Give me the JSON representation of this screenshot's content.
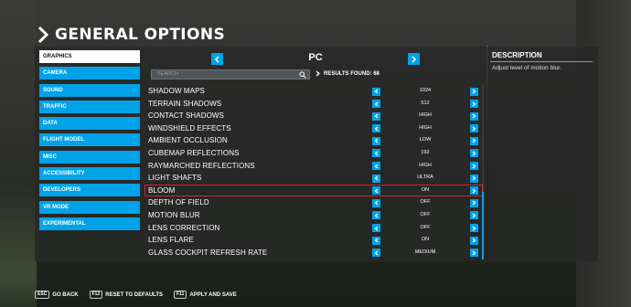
{
  "header": {
    "title": "GENERAL OPTIONS"
  },
  "sidebar": {
    "items": [
      {
        "label": "GRAPHICS",
        "active": true
      },
      {
        "label": "CAMERA"
      },
      {
        "label": "SOUND"
      },
      {
        "label": "TRAFFIC"
      },
      {
        "label": "DATA"
      },
      {
        "label": "FLIGHT MODEL"
      },
      {
        "label": "MISC"
      },
      {
        "label": "ACCESSIBILITY"
      },
      {
        "label": "DEVELOPERS"
      },
      {
        "label": "VR MODE"
      },
      {
        "label": "EXPERIMENTAL"
      }
    ]
  },
  "platform": {
    "label": "PC"
  },
  "search": {
    "placeholder": "SEARCH",
    "results_label": "RESULTS FOUND: 68"
  },
  "settings": [
    {
      "name": "SHADOW MAPS",
      "value": "1024"
    },
    {
      "name": "TERRAIN SHADOWS",
      "value": "512"
    },
    {
      "name": "CONTACT SHADOWS",
      "value": "HIGH"
    },
    {
      "name": "WINDSHIELD EFFECTS",
      "value": "HIGH"
    },
    {
      "name": "AMBIENT OCCLUSION",
      "value": "LOW"
    },
    {
      "name": "CUBEMAP REFLECTIONS",
      "value": "192"
    },
    {
      "name": "RAYMARCHED REFLECTIONS",
      "value": "HIGH"
    },
    {
      "name": "LIGHT SHAFTS",
      "value": "ULTRA"
    },
    {
      "name": "BLOOM",
      "value": "ON",
      "selected": true
    },
    {
      "name": "DEPTH OF FIELD",
      "value": "OFF"
    },
    {
      "name": "MOTION BLUR",
      "value": "OFF"
    },
    {
      "name": "LENS CORRECTION",
      "value": "OFF"
    },
    {
      "name": "LENS FLARE",
      "value": "ON"
    },
    {
      "name": "GLASS COCKPIT REFRESH RATE",
      "value": "MEDIUM"
    }
  ],
  "description": {
    "title": "DESCRIPTION",
    "text": "Adjust level of motion blur."
  },
  "footer": [
    {
      "key": "ESC",
      "label": "GO BACK"
    },
    {
      "key": "F12",
      "label": "RESET TO DEFAULTS"
    },
    {
      "key": "F11",
      "label": "APPLY AND SAVE"
    }
  ],
  "colors": {
    "accent": "#00a3e8",
    "highlight": "#d9232a",
    "panel": "#282928"
  },
  "icons": [
    "chevron-right-icon",
    "chevron-left-icon",
    "search-icon"
  ]
}
